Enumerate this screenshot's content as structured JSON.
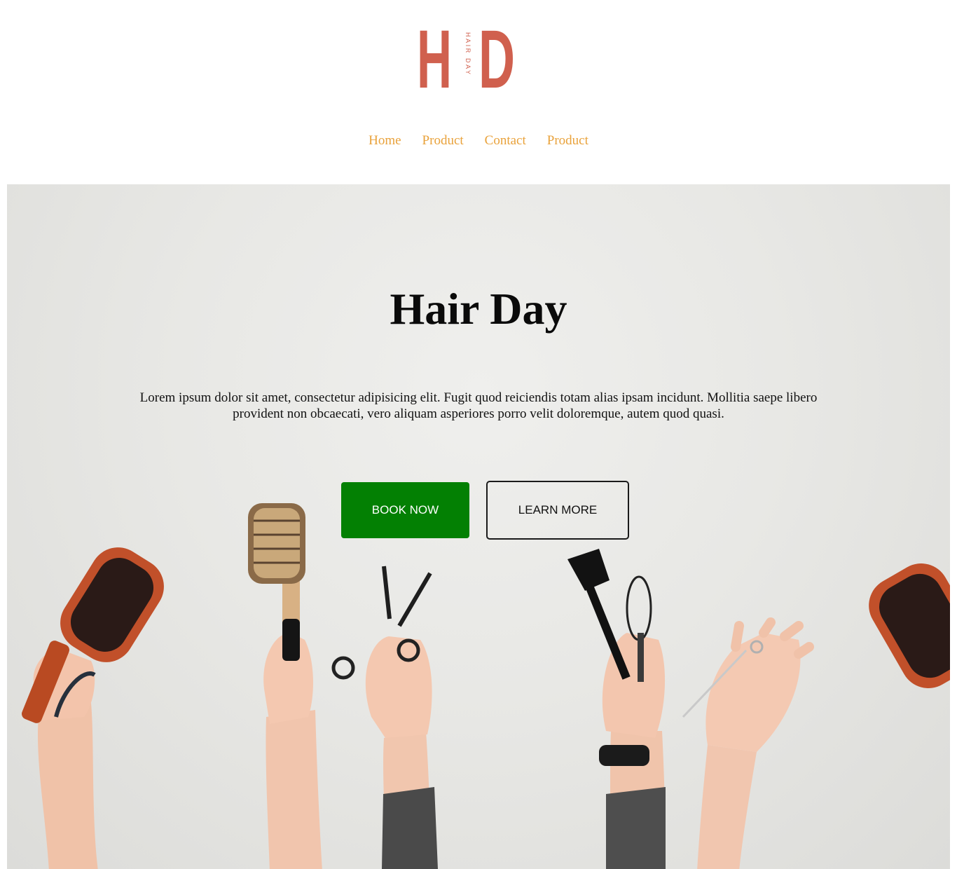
{
  "logo": {
    "left_letter": "H",
    "right_letter": "D",
    "vertical_text": "HAIR DAY",
    "color": "#d0604e"
  },
  "nav": {
    "items": [
      {
        "label": "Home"
      },
      {
        "label": "Product"
      },
      {
        "label": "Contact"
      },
      {
        "label": "Product"
      }
    ],
    "color": "#e9a23b"
  },
  "hero": {
    "title": "Hair Day",
    "text": "Lorem ipsum dolor sit amet, consectetur adipisicing elit. Fugit quod reiciendis totam alias ipsam incidunt. Mollitia saepe libero provident non obcaecati, vero aliquam asperiores porro velit doloremque, autem quod quasi.",
    "book_label": "BOOK NOW",
    "learn_label": "LEARN MORE",
    "book_color": "#038003",
    "image_subject": "hands-holding-hair-tools"
  }
}
